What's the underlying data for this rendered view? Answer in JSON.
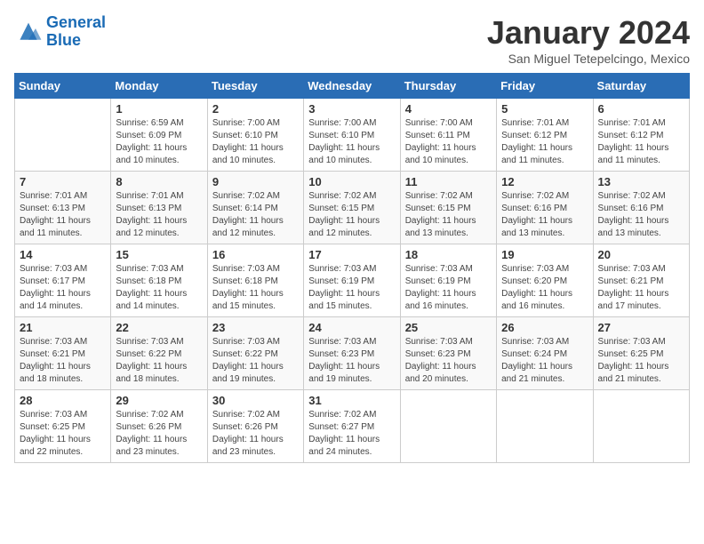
{
  "header": {
    "logo_general": "General",
    "logo_blue": "Blue",
    "month_title": "January 2024",
    "subtitle": "San Miguel Tetepelcingo, Mexico"
  },
  "days_of_week": [
    "Sunday",
    "Monday",
    "Tuesday",
    "Wednesday",
    "Thursday",
    "Friday",
    "Saturday"
  ],
  "weeks": [
    [
      {
        "num": "",
        "info": ""
      },
      {
        "num": "1",
        "info": "Sunrise: 6:59 AM\nSunset: 6:09 PM\nDaylight: 11 hours\nand 10 minutes."
      },
      {
        "num": "2",
        "info": "Sunrise: 7:00 AM\nSunset: 6:10 PM\nDaylight: 11 hours\nand 10 minutes."
      },
      {
        "num": "3",
        "info": "Sunrise: 7:00 AM\nSunset: 6:10 PM\nDaylight: 11 hours\nand 10 minutes."
      },
      {
        "num": "4",
        "info": "Sunrise: 7:00 AM\nSunset: 6:11 PM\nDaylight: 11 hours\nand 10 minutes."
      },
      {
        "num": "5",
        "info": "Sunrise: 7:01 AM\nSunset: 6:12 PM\nDaylight: 11 hours\nand 11 minutes."
      },
      {
        "num": "6",
        "info": "Sunrise: 7:01 AM\nSunset: 6:12 PM\nDaylight: 11 hours\nand 11 minutes."
      }
    ],
    [
      {
        "num": "7",
        "info": "Sunrise: 7:01 AM\nSunset: 6:13 PM\nDaylight: 11 hours\nand 11 minutes."
      },
      {
        "num": "8",
        "info": "Sunrise: 7:01 AM\nSunset: 6:13 PM\nDaylight: 11 hours\nand 12 minutes."
      },
      {
        "num": "9",
        "info": "Sunrise: 7:02 AM\nSunset: 6:14 PM\nDaylight: 11 hours\nand 12 minutes."
      },
      {
        "num": "10",
        "info": "Sunrise: 7:02 AM\nSunset: 6:15 PM\nDaylight: 11 hours\nand 12 minutes."
      },
      {
        "num": "11",
        "info": "Sunrise: 7:02 AM\nSunset: 6:15 PM\nDaylight: 11 hours\nand 13 minutes."
      },
      {
        "num": "12",
        "info": "Sunrise: 7:02 AM\nSunset: 6:16 PM\nDaylight: 11 hours\nand 13 minutes."
      },
      {
        "num": "13",
        "info": "Sunrise: 7:02 AM\nSunset: 6:16 PM\nDaylight: 11 hours\nand 13 minutes."
      }
    ],
    [
      {
        "num": "14",
        "info": "Sunrise: 7:03 AM\nSunset: 6:17 PM\nDaylight: 11 hours\nand 14 minutes."
      },
      {
        "num": "15",
        "info": "Sunrise: 7:03 AM\nSunset: 6:18 PM\nDaylight: 11 hours\nand 14 minutes."
      },
      {
        "num": "16",
        "info": "Sunrise: 7:03 AM\nSunset: 6:18 PM\nDaylight: 11 hours\nand 15 minutes."
      },
      {
        "num": "17",
        "info": "Sunrise: 7:03 AM\nSunset: 6:19 PM\nDaylight: 11 hours\nand 15 minutes."
      },
      {
        "num": "18",
        "info": "Sunrise: 7:03 AM\nSunset: 6:19 PM\nDaylight: 11 hours\nand 16 minutes."
      },
      {
        "num": "19",
        "info": "Sunrise: 7:03 AM\nSunset: 6:20 PM\nDaylight: 11 hours\nand 16 minutes."
      },
      {
        "num": "20",
        "info": "Sunrise: 7:03 AM\nSunset: 6:21 PM\nDaylight: 11 hours\nand 17 minutes."
      }
    ],
    [
      {
        "num": "21",
        "info": "Sunrise: 7:03 AM\nSunset: 6:21 PM\nDaylight: 11 hours\nand 18 minutes."
      },
      {
        "num": "22",
        "info": "Sunrise: 7:03 AM\nSunset: 6:22 PM\nDaylight: 11 hours\nand 18 minutes."
      },
      {
        "num": "23",
        "info": "Sunrise: 7:03 AM\nSunset: 6:22 PM\nDaylight: 11 hours\nand 19 minutes."
      },
      {
        "num": "24",
        "info": "Sunrise: 7:03 AM\nSunset: 6:23 PM\nDaylight: 11 hours\nand 19 minutes."
      },
      {
        "num": "25",
        "info": "Sunrise: 7:03 AM\nSunset: 6:23 PM\nDaylight: 11 hours\nand 20 minutes."
      },
      {
        "num": "26",
        "info": "Sunrise: 7:03 AM\nSunset: 6:24 PM\nDaylight: 11 hours\nand 21 minutes."
      },
      {
        "num": "27",
        "info": "Sunrise: 7:03 AM\nSunset: 6:25 PM\nDaylight: 11 hours\nand 21 minutes."
      }
    ],
    [
      {
        "num": "28",
        "info": "Sunrise: 7:03 AM\nSunset: 6:25 PM\nDaylight: 11 hours\nand 22 minutes."
      },
      {
        "num": "29",
        "info": "Sunrise: 7:02 AM\nSunset: 6:26 PM\nDaylight: 11 hours\nand 23 minutes."
      },
      {
        "num": "30",
        "info": "Sunrise: 7:02 AM\nSunset: 6:26 PM\nDaylight: 11 hours\nand 23 minutes."
      },
      {
        "num": "31",
        "info": "Sunrise: 7:02 AM\nSunset: 6:27 PM\nDaylight: 11 hours\nand 24 minutes."
      },
      {
        "num": "",
        "info": ""
      },
      {
        "num": "",
        "info": ""
      },
      {
        "num": "",
        "info": ""
      }
    ]
  ]
}
